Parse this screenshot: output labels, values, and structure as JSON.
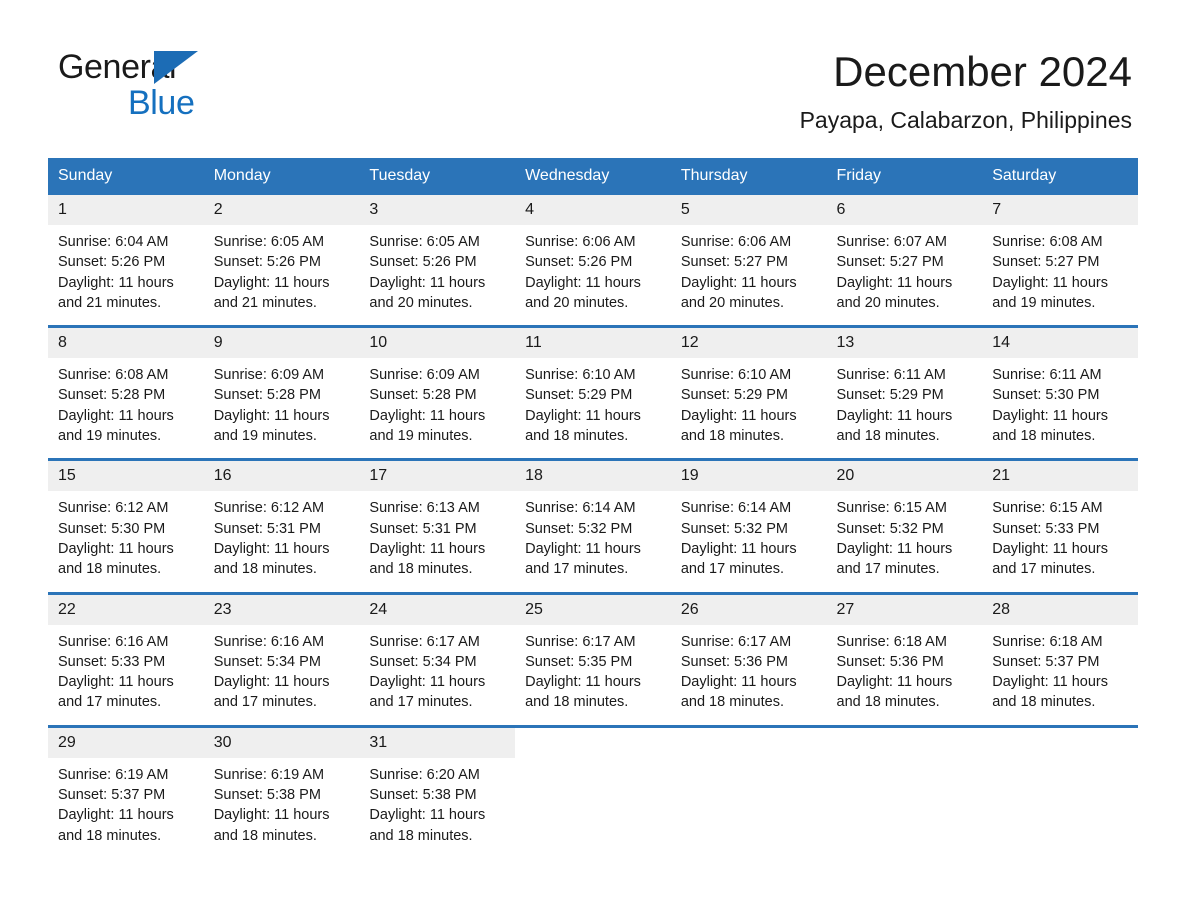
{
  "brand": {
    "name_part1": "General",
    "name_part2": "Blue",
    "triangle_color": "#1c6cb5",
    "blue_text_color": "#1570bf"
  },
  "header": {
    "title": "December 2024",
    "location": "Payapa, Calabarzon, Philippines"
  },
  "theme": {
    "header_blue": "#2b74b8",
    "day_band_gray": "#efefef",
    "text_color": "#1a1a1a"
  },
  "weekday_headers": [
    "Sunday",
    "Monday",
    "Tuesday",
    "Wednesday",
    "Thursday",
    "Friday",
    "Saturday"
  ],
  "weeks": [
    [
      {
        "day": "1",
        "sunrise": "Sunrise: 6:04 AM",
        "sunset": "Sunset: 5:26 PM",
        "daylight_line1": "Daylight: 11 hours",
        "daylight_line2": "and 21 minutes."
      },
      {
        "day": "2",
        "sunrise": "Sunrise: 6:05 AM",
        "sunset": "Sunset: 5:26 PM",
        "daylight_line1": "Daylight: 11 hours",
        "daylight_line2": "and 21 minutes."
      },
      {
        "day": "3",
        "sunrise": "Sunrise: 6:05 AM",
        "sunset": "Sunset: 5:26 PM",
        "daylight_line1": "Daylight: 11 hours",
        "daylight_line2": "and 20 minutes."
      },
      {
        "day": "4",
        "sunrise": "Sunrise: 6:06 AM",
        "sunset": "Sunset: 5:26 PM",
        "daylight_line1": "Daylight: 11 hours",
        "daylight_line2": "and 20 minutes."
      },
      {
        "day": "5",
        "sunrise": "Sunrise: 6:06 AM",
        "sunset": "Sunset: 5:27 PM",
        "daylight_line1": "Daylight: 11 hours",
        "daylight_line2": "and 20 minutes."
      },
      {
        "day": "6",
        "sunrise": "Sunrise: 6:07 AM",
        "sunset": "Sunset: 5:27 PM",
        "daylight_line1": "Daylight: 11 hours",
        "daylight_line2": "and 20 minutes."
      },
      {
        "day": "7",
        "sunrise": "Sunrise: 6:08 AM",
        "sunset": "Sunset: 5:27 PM",
        "daylight_line1": "Daylight: 11 hours",
        "daylight_line2": "and 19 minutes."
      }
    ],
    [
      {
        "day": "8",
        "sunrise": "Sunrise: 6:08 AM",
        "sunset": "Sunset: 5:28 PM",
        "daylight_line1": "Daylight: 11 hours",
        "daylight_line2": "and 19 minutes."
      },
      {
        "day": "9",
        "sunrise": "Sunrise: 6:09 AM",
        "sunset": "Sunset: 5:28 PM",
        "daylight_line1": "Daylight: 11 hours",
        "daylight_line2": "and 19 minutes."
      },
      {
        "day": "10",
        "sunrise": "Sunrise: 6:09 AM",
        "sunset": "Sunset: 5:28 PM",
        "daylight_line1": "Daylight: 11 hours",
        "daylight_line2": "and 19 minutes."
      },
      {
        "day": "11",
        "sunrise": "Sunrise: 6:10 AM",
        "sunset": "Sunset: 5:29 PM",
        "daylight_line1": "Daylight: 11 hours",
        "daylight_line2": "and 18 minutes."
      },
      {
        "day": "12",
        "sunrise": "Sunrise: 6:10 AM",
        "sunset": "Sunset: 5:29 PM",
        "daylight_line1": "Daylight: 11 hours",
        "daylight_line2": "and 18 minutes."
      },
      {
        "day": "13",
        "sunrise": "Sunrise: 6:11 AM",
        "sunset": "Sunset: 5:29 PM",
        "daylight_line1": "Daylight: 11 hours",
        "daylight_line2": "and 18 minutes."
      },
      {
        "day": "14",
        "sunrise": "Sunrise: 6:11 AM",
        "sunset": "Sunset: 5:30 PM",
        "daylight_line1": "Daylight: 11 hours",
        "daylight_line2": "and 18 minutes."
      }
    ],
    [
      {
        "day": "15",
        "sunrise": "Sunrise: 6:12 AM",
        "sunset": "Sunset: 5:30 PM",
        "daylight_line1": "Daylight: 11 hours",
        "daylight_line2": "and 18 minutes."
      },
      {
        "day": "16",
        "sunrise": "Sunrise: 6:12 AM",
        "sunset": "Sunset: 5:31 PM",
        "daylight_line1": "Daylight: 11 hours",
        "daylight_line2": "and 18 minutes."
      },
      {
        "day": "17",
        "sunrise": "Sunrise: 6:13 AM",
        "sunset": "Sunset: 5:31 PM",
        "daylight_line1": "Daylight: 11 hours",
        "daylight_line2": "and 18 minutes."
      },
      {
        "day": "18",
        "sunrise": "Sunrise: 6:14 AM",
        "sunset": "Sunset: 5:32 PM",
        "daylight_line1": "Daylight: 11 hours",
        "daylight_line2": "and 17 minutes."
      },
      {
        "day": "19",
        "sunrise": "Sunrise: 6:14 AM",
        "sunset": "Sunset: 5:32 PM",
        "daylight_line1": "Daylight: 11 hours",
        "daylight_line2": "and 17 minutes."
      },
      {
        "day": "20",
        "sunrise": "Sunrise: 6:15 AM",
        "sunset": "Sunset: 5:32 PM",
        "daylight_line1": "Daylight: 11 hours",
        "daylight_line2": "and 17 minutes."
      },
      {
        "day": "21",
        "sunrise": "Sunrise: 6:15 AM",
        "sunset": "Sunset: 5:33 PM",
        "daylight_line1": "Daylight: 11 hours",
        "daylight_line2": "and 17 minutes."
      }
    ],
    [
      {
        "day": "22",
        "sunrise": "Sunrise: 6:16 AM",
        "sunset": "Sunset: 5:33 PM",
        "daylight_line1": "Daylight: 11 hours",
        "daylight_line2": "and 17 minutes."
      },
      {
        "day": "23",
        "sunrise": "Sunrise: 6:16 AM",
        "sunset": "Sunset: 5:34 PM",
        "daylight_line1": "Daylight: 11 hours",
        "daylight_line2": "and 17 minutes."
      },
      {
        "day": "24",
        "sunrise": "Sunrise: 6:17 AM",
        "sunset": "Sunset: 5:34 PM",
        "daylight_line1": "Daylight: 11 hours",
        "daylight_line2": "and 17 minutes."
      },
      {
        "day": "25",
        "sunrise": "Sunrise: 6:17 AM",
        "sunset": "Sunset: 5:35 PM",
        "daylight_line1": "Daylight: 11 hours",
        "daylight_line2": "and 18 minutes."
      },
      {
        "day": "26",
        "sunrise": "Sunrise: 6:17 AM",
        "sunset": "Sunset: 5:36 PM",
        "daylight_line1": "Daylight: 11 hours",
        "daylight_line2": "and 18 minutes."
      },
      {
        "day": "27",
        "sunrise": "Sunrise: 6:18 AM",
        "sunset": "Sunset: 5:36 PM",
        "daylight_line1": "Daylight: 11 hours",
        "daylight_line2": "and 18 minutes."
      },
      {
        "day": "28",
        "sunrise": "Sunrise: 6:18 AM",
        "sunset": "Sunset: 5:37 PM",
        "daylight_line1": "Daylight: 11 hours",
        "daylight_line2": "and 18 minutes."
      }
    ],
    [
      {
        "day": "29",
        "sunrise": "Sunrise: 6:19 AM",
        "sunset": "Sunset: 5:37 PM",
        "daylight_line1": "Daylight: 11 hours",
        "daylight_line2": "and 18 minutes."
      },
      {
        "day": "30",
        "sunrise": "Sunrise: 6:19 AM",
        "sunset": "Sunset: 5:38 PM",
        "daylight_line1": "Daylight: 11 hours",
        "daylight_line2": "and 18 minutes."
      },
      {
        "day": "31",
        "sunrise": "Sunrise: 6:20 AM",
        "sunset": "Sunset: 5:38 PM",
        "daylight_line1": "Daylight: 11 hours",
        "daylight_line2": "and 18 minutes."
      },
      {
        "day": "",
        "sunrise": "",
        "sunset": "",
        "daylight_line1": "",
        "daylight_line2": ""
      },
      {
        "day": "",
        "sunrise": "",
        "sunset": "",
        "daylight_line1": "",
        "daylight_line2": ""
      },
      {
        "day": "",
        "sunrise": "",
        "sunset": "",
        "daylight_line1": "",
        "daylight_line2": ""
      },
      {
        "day": "",
        "sunrise": "",
        "sunset": "",
        "daylight_line1": "",
        "daylight_line2": ""
      }
    ]
  ]
}
